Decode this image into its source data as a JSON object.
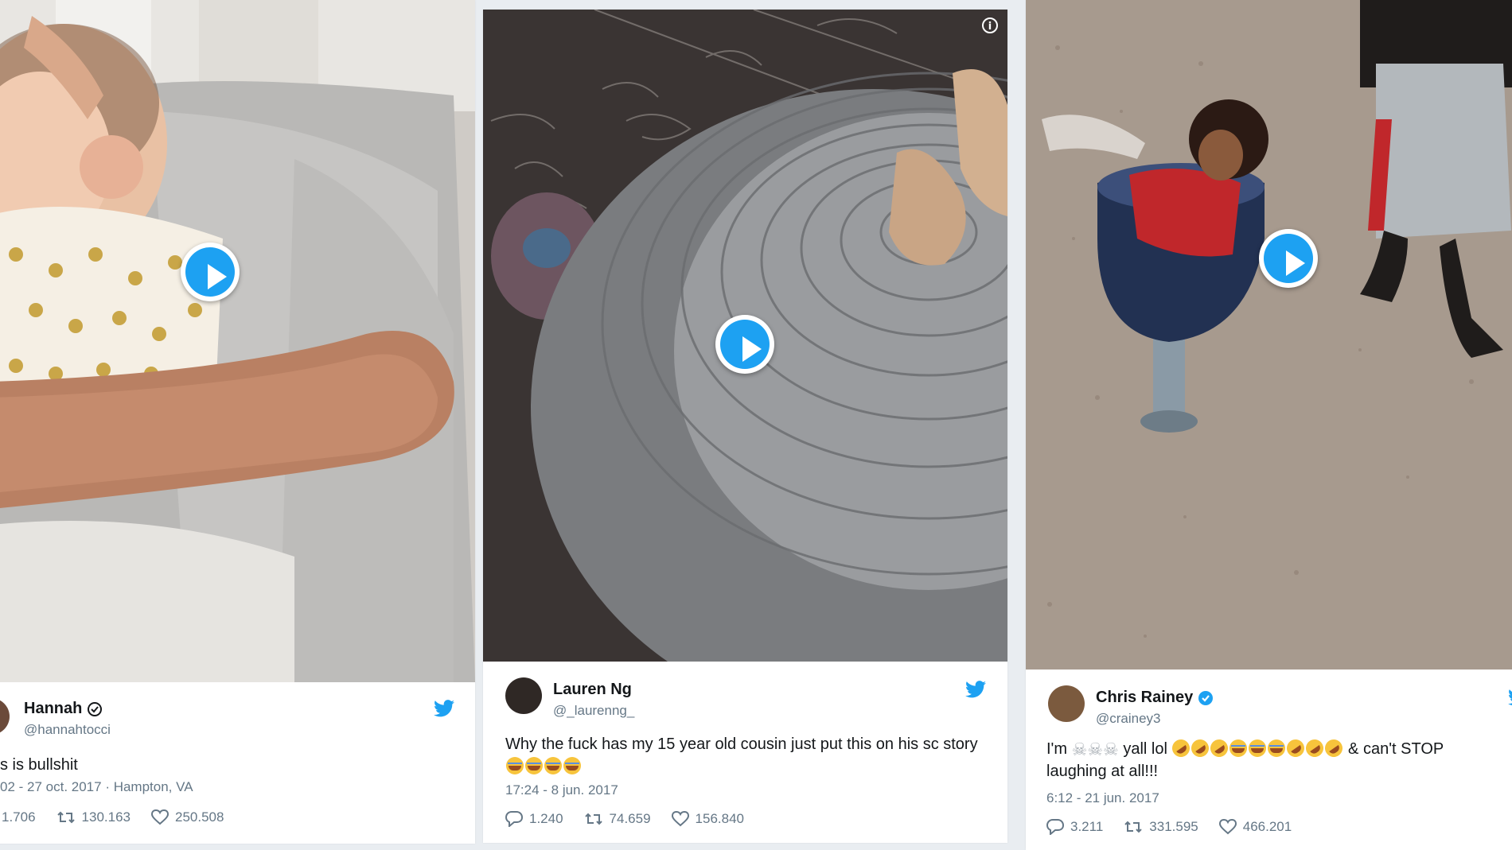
{
  "tweets": [
    {
      "name": "Hannah",
      "handle": "@hannahtocci",
      "text": "s is bullshit",
      "meta": "02 - 27 oct. 2017 · Hampton, VA",
      "replies": "1.706",
      "retweets": "130.163",
      "likes": "250.508"
    },
    {
      "name": "Lauren Ng",
      "handle": "@_laurenng_",
      "text": "Why the fuck has my 15 year old cousin just put this on his sc story",
      "meta": "17:24 - 8 jun. 2017",
      "replies": "1.240",
      "retweets": "74.659",
      "likes": "156.840"
    },
    {
      "name": "Chris Rainey",
      "handle": "@crainey3",
      "text_start": "I'm",
      "text_mid": "yall lol",
      "text_end": "& can't STOP",
      "text_line2": "laughing at all!!!",
      "meta": "6:12 - 21 jun. 2017",
      "replies": "3.211",
      "retweets": "331.595",
      "likes": "466.201"
    }
  ],
  "icons": {
    "play": "play-icon",
    "bird": "twitter-bird-icon",
    "reply": "reply-icon",
    "retweet": "retweet-icon",
    "like": "heart-icon",
    "verified": "verified-badge-icon",
    "info": "info-icon"
  },
  "colors": {
    "twitter_blue": "#1da1f2",
    "text": "#14171a",
    "muted": "#657786",
    "background": "#e9edf1"
  }
}
